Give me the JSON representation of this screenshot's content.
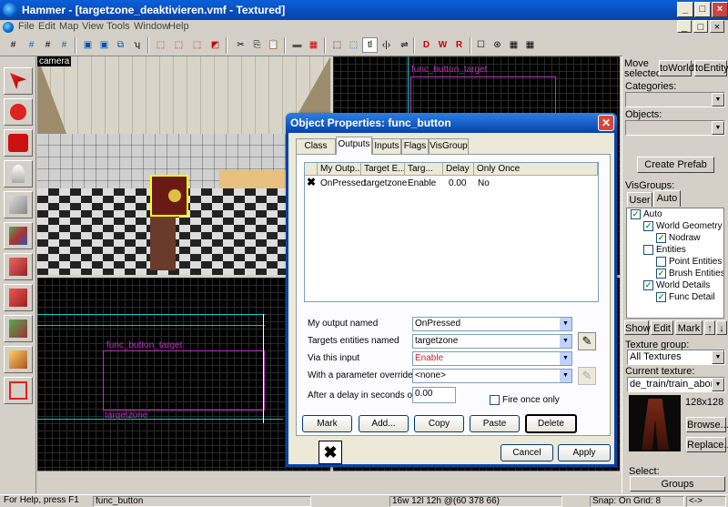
{
  "window": {
    "title": "Hammer - [targetzone_deaktivieren.vmf - Textured]",
    "min": "_",
    "max": "□",
    "close": "×"
  },
  "menu": [
    "File",
    "Edit",
    "Map",
    "View",
    "Tools",
    "Window",
    "Help"
  ],
  "viewports": {
    "camera_label": "camera",
    "top_right_entity": "func_button_target",
    "bottom_left_entity": "func_button_target",
    "bottom_left_target": "targetzone"
  },
  "right_panel": {
    "move_selected": "Move selected:",
    "to_world": "toWorld",
    "to_entity": "toEntity",
    "categories": "Categories:",
    "objects": "Objects:",
    "create_prefab": "Create Prefab",
    "visgroups": "VisGroups:",
    "tab_user": "User",
    "tab_auto": "Auto",
    "tree": [
      {
        "label": "Auto",
        "checked": "✓",
        "indent": 0
      },
      {
        "label": "World Geometry",
        "checked": "✓",
        "indent": 1
      },
      {
        "label": "Nodraw",
        "checked": "✓",
        "indent": 2
      },
      {
        "label": "Entities",
        "checked": "",
        "indent": 1
      },
      {
        "label": "Point Entities",
        "checked": "",
        "indent": 2
      },
      {
        "label": "Brush Entities",
        "checked": "✓",
        "indent": 2
      },
      {
        "label": "World Details",
        "checked": "✓",
        "indent": 1
      },
      {
        "label": "Func Detail",
        "checked": "✓",
        "indent": 2
      }
    ],
    "show": "Show",
    "edit": "Edit",
    "mark": "Mark",
    "up": "↑",
    "down": "↓",
    "texture_group": "Texture group:",
    "texture_group_value": "All Textures",
    "current_texture": "Current texture:",
    "current_texture_value": "de_train/train_abombsite",
    "texture_size": "128x128",
    "browse": "Browse...",
    "replace": "Replace...",
    "select": "Select:",
    "select_value": "Groups"
  },
  "status": {
    "help": "For Help, press F1",
    "selection": "func_button",
    "coords": "16w 12l 12h @(60 378 66)",
    "snap": "Snap: On Grid: 8",
    "arrows": "<->"
  },
  "dialog": {
    "title": "Object Properties: func_button",
    "close": "✕",
    "tabs": [
      "Class Info",
      "Outputs",
      "Inputs",
      "Flags",
      "VisGroup"
    ],
    "columns": [
      "",
      "My Outp...",
      "Target E...",
      "Targ...",
      "Delay",
      "Only Once"
    ],
    "rows": [
      {
        "output": "OnPressed",
        "target": "targetzone",
        "input": "Enable",
        "delay": "0.00",
        "once": "No"
      }
    ],
    "my_output_named": "My output named",
    "my_output_value": "OnPressed",
    "targets_named": "Targets entities named",
    "targets_value": "targetzone",
    "via_input": "Via this input",
    "via_input_value": "Enable",
    "param_override": "With a parameter override of",
    "param_value": "<none>",
    "delay_label": "After a delay in seconds of",
    "delay_value": "0.00",
    "fire_once": "Fire once only",
    "mark": "Mark",
    "add": "Add...",
    "copy": "Copy",
    "paste": "Paste",
    "delete": "Delete",
    "cancel": "Cancel",
    "apply": "Apply"
  },
  "colors": {
    "title_blue": "#0842a8",
    "entity_magenta": "#c030c0",
    "invalid_red": "#d02020"
  }
}
